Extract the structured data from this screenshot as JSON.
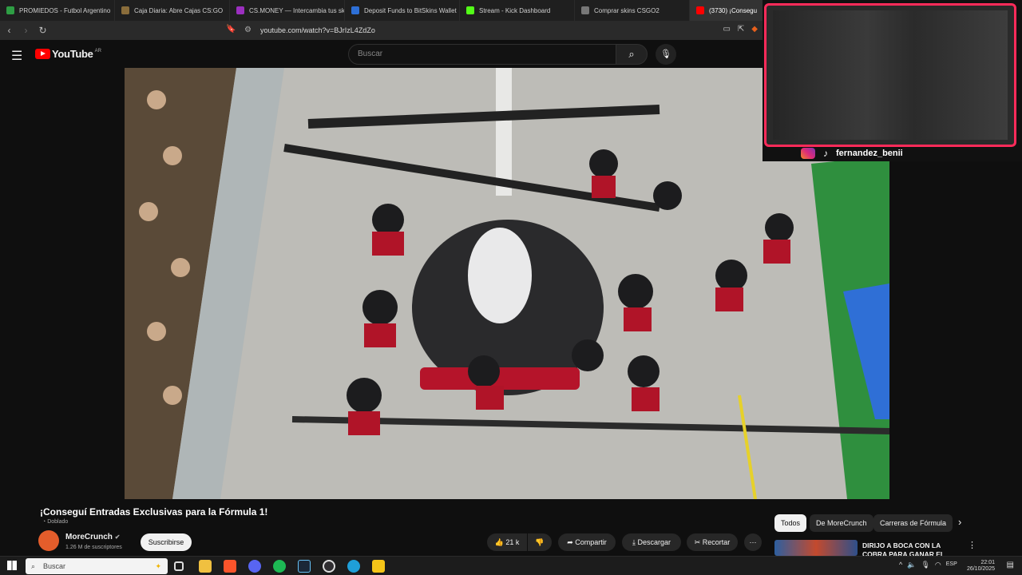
{
  "browser": {
    "tabs": [
      {
        "label": "PROMIEDOS - Futbol Argentino",
        "color": "#2e9e44"
      },
      {
        "label": "Caja Diaria: Abre Cajas CS:GO",
        "color": "#8a6d3b"
      },
      {
        "label": "CS.MONEY — Intercambia tus ski",
        "color": "#9b2fbf"
      },
      {
        "label": "Deposit Funds to BitSkins Wallet",
        "color": "#2d6fd6"
      },
      {
        "label": "Stream - Kick Dashboard",
        "color": "#53fc18"
      },
      {
        "label": "Comprar skins CSGO2",
        "color": "#777777"
      },
      {
        "label": "(3730) ¡Consegu",
        "color": "#ff0000"
      }
    ],
    "url": "youtube.com/watch?v=BJrIzL4ZdZo"
  },
  "youtube": {
    "logo_text": "YouTube",
    "region": "AR",
    "search_placeholder": "Buscar"
  },
  "facecam": {
    "handle": "fernandez_benii",
    "accent": "#ff2b5a"
  },
  "video": {
    "title": "¡Conseguí Entradas Exclusivas para la Fórmula 1!",
    "dub_label": "Doblado",
    "channel": "MoreCrunch",
    "subscribers": "1.26 M de suscriptores",
    "subscribe_label": "Suscribirse",
    "likes": "21 k",
    "share_label": "Compartir",
    "download_label": "Descargar",
    "clip_label": "Recortar"
  },
  "chips": [
    "Todos",
    "De MoreCrunch",
    "Carreras de Fórmula"
  ],
  "recommendation": {
    "title": "DIRIJO A BOCA CON LA COBRA PARA GANAR EL"
  },
  "taskbar": {
    "search_placeholder": "Buscar",
    "lang": "ESP",
    "time": "22:01",
    "date": "26/10/2025"
  }
}
